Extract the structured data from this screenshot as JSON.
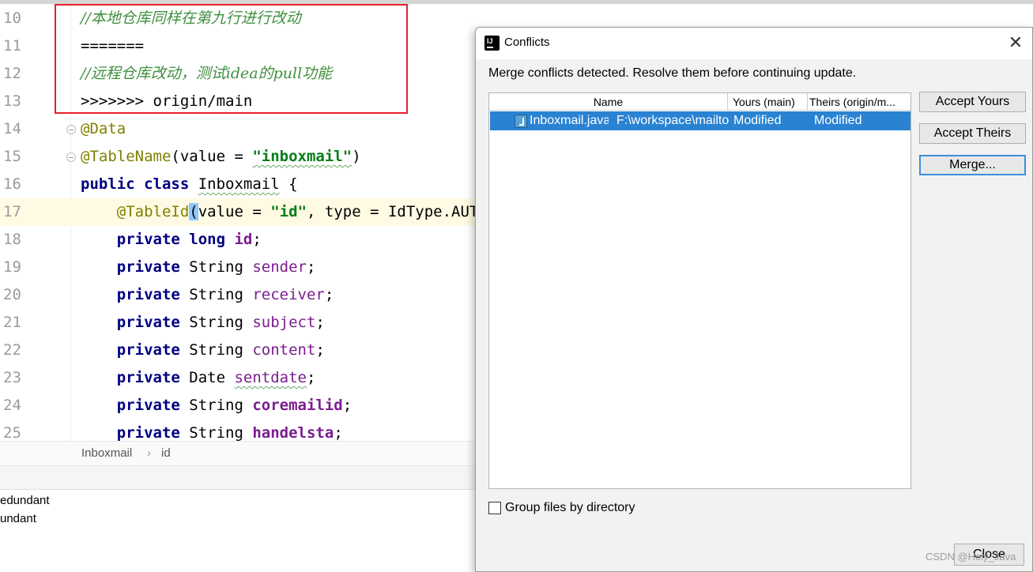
{
  "editor": {
    "lines": [
      {
        "num": "10",
        "segments": [
          {
            "text": "//本地仓库同样在第九行进行改动",
            "cls": "cmt"
          }
        ]
      },
      {
        "num": "11",
        "segments": [
          {
            "text": "=======",
            "cls": ""
          }
        ]
      },
      {
        "num": "12",
        "segments": [
          {
            "text": "//远程仓库改动，测试idea的pull功能",
            "cls": "cmt"
          }
        ]
      },
      {
        "num": "13",
        "segments": [
          {
            "text": ">>>>>>> origin/main",
            "cls": ""
          }
        ]
      },
      {
        "num": "14",
        "segments": [
          {
            "text": "@Data",
            "cls": "ann"
          }
        ]
      },
      {
        "num": "15",
        "segments": [
          {
            "text": "@TableName",
            "cls": "ann"
          },
          {
            "text": "(value = ",
            "cls": ""
          },
          {
            "text": "\"inboxmail\"",
            "cls": "str squig"
          },
          {
            "text": ")",
            "cls": ""
          }
        ]
      },
      {
        "num": "16",
        "segments": [
          {
            "text": "public class ",
            "cls": "kw"
          },
          {
            "text": "Inboxmail",
            "cls": "squig"
          },
          {
            "text": " {",
            "cls": ""
          }
        ]
      },
      {
        "num": "17",
        "current": true,
        "segments": [
          {
            "text": "    ",
            "cls": ""
          },
          {
            "text": "@TableId",
            "cls": "ann"
          },
          {
            "text": "(",
            "cls": "paren-hl"
          },
          {
            "text": "value = ",
            "cls": ""
          },
          {
            "text": "\"id\"",
            "cls": "str"
          },
          {
            "text": ", type = IdType.AUTO)",
            "cls": ""
          }
        ]
      },
      {
        "num": "18",
        "segments": [
          {
            "text": "    ",
            "cls": ""
          },
          {
            "text": "private long ",
            "cls": "kw"
          },
          {
            "text": "id",
            "cls": "fld bold"
          },
          {
            "text": ";",
            "cls": ""
          }
        ]
      },
      {
        "num": "19",
        "segments": [
          {
            "text": "    ",
            "cls": ""
          },
          {
            "text": "private ",
            "cls": "kw"
          },
          {
            "text": "String ",
            "cls": ""
          },
          {
            "text": "sender",
            "cls": "fld"
          },
          {
            "text": ";",
            "cls": ""
          }
        ]
      },
      {
        "num": "20",
        "segments": [
          {
            "text": "    ",
            "cls": ""
          },
          {
            "text": "private ",
            "cls": "kw"
          },
          {
            "text": "String ",
            "cls": ""
          },
          {
            "text": "receiver",
            "cls": "fld"
          },
          {
            "text": ";",
            "cls": ""
          }
        ]
      },
      {
        "num": "21",
        "segments": [
          {
            "text": "    ",
            "cls": ""
          },
          {
            "text": "private ",
            "cls": "kw"
          },
          {
            "text": "String ",
            "cls": ""
          },
          {
            "text": "subject",
            "cls": "fld"
          },
          {
            "text": ";",
            "cls": ""
          }
        ]
      },
      {
        "num": "22",
        "segments": [
          {
            "text": "    ",
            "cls": ""
          },
          {
            "text": "private ",
            "cls": "kw"
          },
          {
            "text": "String ",
            "cls": ""
          },
          {
            "text": "content",
            "cls": "fld"
          },
          {
            "text": ";",
            "cls": ""
          }
        ]
      },
      {
        "num": "23",
        "segments": [
          {
            "text": "    ",
            "cls": ""
          },
          {
            "text": "private ",
            "cls": "kw"
          },
          {
            "text": "Date ",
            "cls": ""
          },
          {
            "text": "sentdate",
            "cls": "fld squig"
          },
          {
            "text": ";",
            "cls": ""
          }
        ]
      },
      {
        "num": "24",
        "segments": [
          {
            "text": "    ",
            "cls": ""
          },
          {
            "text": "private ",
            "cls": "kw"
          },
          {
            "text": "String ",
            "cls": ""
          },
          {
            "text": "coremailid",
            "cls": "fld bold"
          },
          {
            "text": ";",
            "cls": ""
          }
        ]
      },
      {
        "num": "25",
        "segments": [
          {
            "text": "    ",
            "cls": ""
          },
          {
            "text": "private ",
            "cls": "kw"
          },
          {
            "text": "String ",
            "cls": ""
          },
          {
            "text": "handelsta",
            "cls": "fld bold"
          },
          {
            "text": ";",
            "cls": ""
          }
        ]
      }
    ]
  },
  "breadcrumb": {
    "class_name": "Inboxmail",
    "separator": "›",
    "field_name": "id"
  },
  "bottom_panel": {
    "line1": "edundant",
    "line2": "undant",
    "line3": ""
  },
  "dialog": {
    "title": "Conflicts",
    "close_glyph": "✕",
    "message": "Merge conflicts detected. Resolve them before continuing update.",
    "table": {
      "headers": {
        "name": "Name",
        "yours": "Yours (main)",
        "theirs": "Theirs (origin/m..."
      },
      "rows": [
        {
          "name": "Inboxmail.java",
          "path": "F:\\workspace\\mailto",
          "yours": "Modified",
          "theirs": "Modified"
        }
      ]
    },
    "buttons": {
      "accept_yours": "Accept Yours",
      "accept_theirs": "Accept Theirs",
      "merge": "Merge...",
      "close": "Close"
    },
    "group_by_directory": {
      "label": "Group files by directory",
      "checked": false
    }
  },
  "watermark": "CSDN @Holy_Java",
  "colors": {
    "conflict_highlight": "#e8212d",
    "selection": "#2a83d2",
    "comment": "#3f8f3f",
    "keyword": "#000080",
    "string": "#067d17",
    "field": "#7b1d8f",
    "annotation": "#808000"
  },
  "icons": {
    "app": "intellij-idea-icon",
    "file": "java-file-icon",
    "close": "close-icon"
  }
}
